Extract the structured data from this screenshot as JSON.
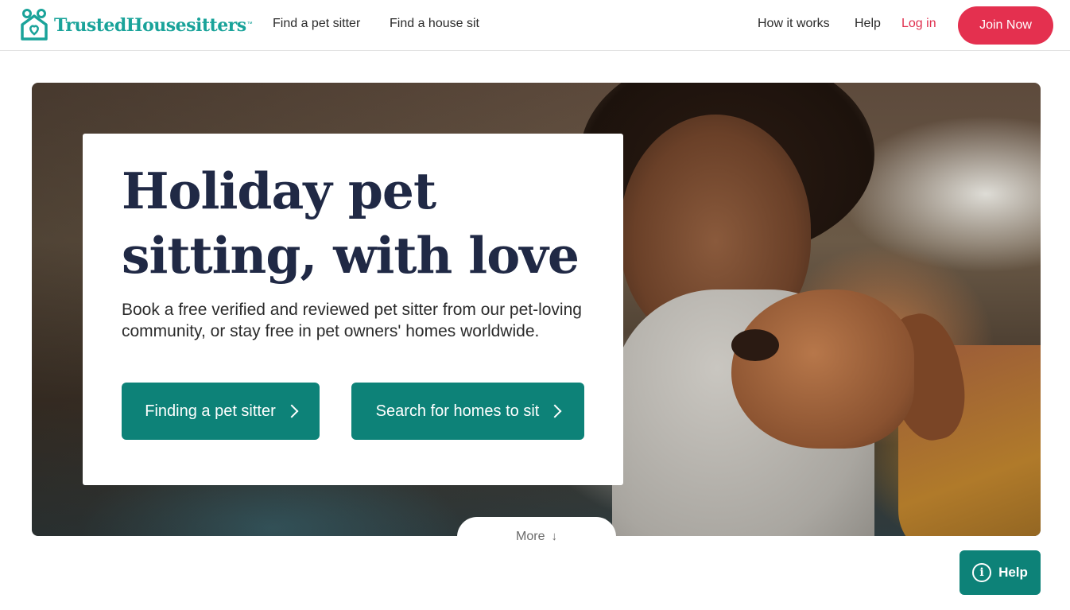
{
  "header": {
    "logo_text": "TrustedHousesitters",
    "logo_tm": "™",
    "nav_left": [
      {
        "label": "Find a pet sitter"
      },
      {
        "label": "Find a house sit"
      }
    ],
    "nav_right": [
      {
        "label": "How it works"
      },
      {
        "label": "Help"
      },
      {
        "label": "Log in"
      }
    ],
    "join_label": "Join Now"
  },
  "hero": {
    "title_line1": "Holiday pet",
    "title_line2": "sitting, with love",
    "subtitle": "Book a free verified and reviewed pet sitter from our pet-loving community, or stay free in pet owners' homes worldwide.",
    "cta_primary": "Finding a pet sitter",
    "cta_secondary": "Search for homes to sit",
    "more_label": "More",
    "more_icon": "arrow-down-icon"
  },
  "help_widget": {
    "label": "Help",
    "icon": "info-icon"
  },
  "colors": {
    "brand_teal": "#1aa39a",
    "button_teal": "#0d8278",
    "accent_red": "#e4304f",
    "heading_navy": "#202945"
  }
}
